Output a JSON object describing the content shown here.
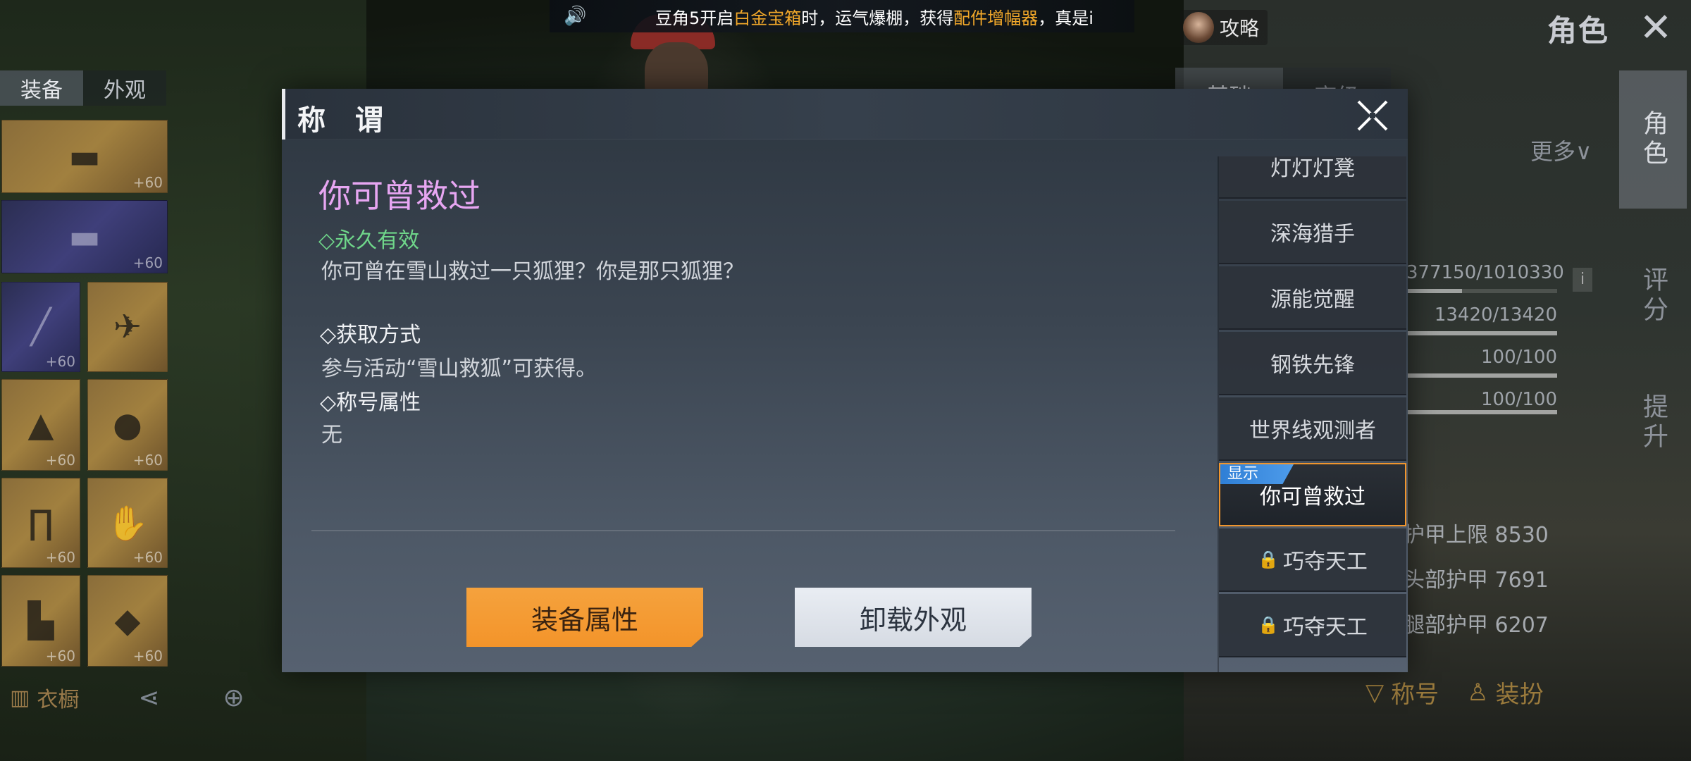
{
  "marquee": {
    "prefix": "豆角5开启",
    "item1": "白金宝箱",
    "middle": "时，运气爆棚，获得",
    "item2": "配件增幅器",
    "suffix": "，真是i"
  },
  "header": {
    "guide_label": "攻略",
    "role_title": "角色"
  },
  "inventory": {
    "tabs": [
      "装备",
      "外观"
    ],
    "slot_level": "+60",
    "bottom": {
      "wardrobe": "衣橱"
    }
  },
  "right_panel": {
    "tabs": [
      "基础",
      "高级"
    ],
    "more": "更多",
    "stats": [
      "377150/1010330",
      "13420/13420",
      "100/100",
      "100/100"
    ],
    "armor": [
      "护甲上限 8530",
      "头部护甲 7691",
      "腿部护甲 6207"
    ],
    "rail": [
      "角色",
      "评分",
      "提升"
    ],
    "bottom": {
      "titles": "称号",
      "dressup": "装扮"
    }
  },
  "modal": {
    "title": "称 谓",
    "selected": {
      "name": "你可曾救过",
      "validity": "◇永久有效",
      "description": "你可曾在雪山救过一只狐狸？你是那只狐狸？",
      "obtain_label": "◇获取方式",
      "obtain_body": "参与活动“雪山救狐”可获得。",
      "attr_label": "◇称号属性",
      "attr_body": "无"
    },
    "buttons": {
      "equip": "装备属性",
      "unload": "卸载外观"
    },
    "shown_badge": "显示",
    "titles": [
      {
        "label": "灯灯灯凳",
        "locked": false
      },
      {
        "label": "深海猎手",
        "locked": false
      },
      {
        "label": "源能觉醒",
        "locked": false
      },
      {
        "label": "钢铁先锋",
        "locked": false
      },
      {
        "label": "世界线观测者",
        "locked": false
      },
      {
        "label": "你可曾救过",
        "locked": false,
        "selected": true
      },
      {
        "label": "巧夺天工",
        "locked": true
      },
      {
        "label": "巧夺天工",
        "locked": true
      }
    ]
  },
  "colors": {
    "accent_orange": "#f3942a",
    "title_purple": "#e7a6f2",
    "validity_green": "#6fd68a",
    "badge_blue": "#2f7fd6"
  }
}
